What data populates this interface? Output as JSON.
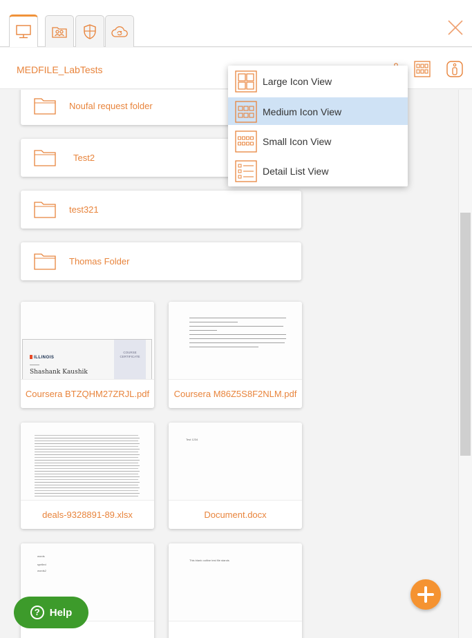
{
  "header": {
    "breadcrumb": "MEDFILE_LabTests"
  },
  "tabs": [
    {
      "icon": "computer-icon",
      "active": true
    },
    {
      "icon": "shared-users-icon",
      "active": false
    },
    {
      "icon": "security-shield-icon",
      "active": false
    },
    {
      "icon": "cloud-sync-icon",
      "active": false
    }
  ],
  "folders": [
    {
      "name": "Noufal request folder"
    },
    {
      "name": "Test2"
    },
    {
      "name": "test321"
    },
    {
      "name": "Thomas Folder"
    }
  ],
  "files": [
    {
      "name": "Coursera BTZQHM27ZRJL.pdf"
    },
    {
      "name": "Coursera M86Z5S8F2NLM.pdf"
    },
    {
      "name": "deals-9328891-89.xlsx"
    },
    {
      "name": "Document.docx"
    },
    {
      "name": ""
    },
    {
      "name": ""
    }
  ],
  "thumbs": {
    "cert_logo": "ILLINOIS",
    "cert_name": "Shashank Kaushik",
    "cert_side": "COURSE CERTIFICATE",
    "doc_text": "Test 1234",
    "list_lines": [
      "words",
      "spelled",
      "words2"
    ],
    "blank_text": "This blank outline test file stands"
  },
  "view_menu": {
    "items": [
      {
        "label": "Large Icon View",
        "icon": "large-icon-view-icon",
        "selected": false
      },
      {
        "label": "Medium Icon View",
        "icon": "medium-icon-view-icon",
        "selected": true
      },
      {
        "label": "Small Icon View",
        "icon": "small-icon-view-icon",
        "selected": false
      },
      {
        "label": "Detail List View",
        "icon": "detail-list-view-icon",
        "selected": false
      }
    ]
  },
  "help": {
    "label": "Help"
  },
  "colors": {
    "accent": "#e8843c",
    "help_green": "#3d9b2b",
    "fab_orange": "#f59331",
    "selected_row": "#cfe2f5"
  }
}
